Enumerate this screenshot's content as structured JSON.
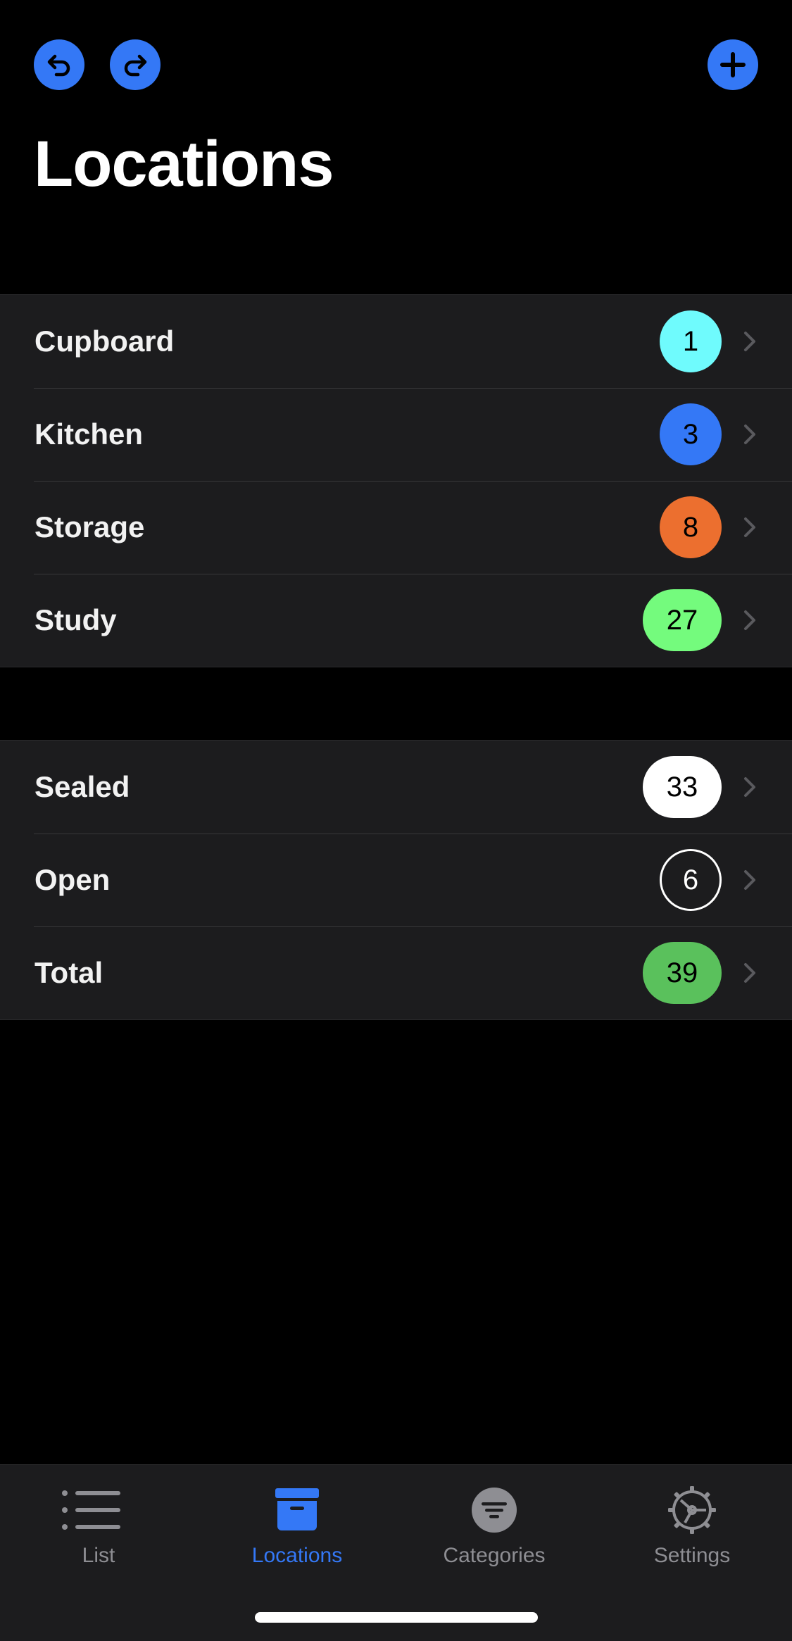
{
  "header": {
    "title": "Locations",
    "undo_icon": "undo-icon",
    "redo_icon": "redo-icon",
    "add_icon": "plus-icon",
    "accent_color": "#3478f6"
  },
  "locations": [
    {
      "label": "Cupboard",
      "count": "1",
      "color": "#6ffbfd"
    },
    {
      "label": "Kitchen",
      "count": "3",
      "color": "#3478f6"
    },
    {
      "label": "Storage",
      "count": "8",
      "color": "#ec6f2f"
    },
    {
      "label": "Study",
      "count": "27",
      "color": "#74fb7d"
    }
  ],
  "status": [
    {
      "label": "Sealed",
      "count": "33",
      "color": "#ffffff"
    },
    {
      "label": "Open",
      "count": "6",
      "color": "outline-white"
    },
    {
      "label": "Total",
      "count": "39",
      "color": "#5ac15c"
    }
  ],
  "tabbar": {
    "tabs": [
      {
        "label": "List",
        "icon": "list-icon",
        "active": false
      },
      {
        "label": "Locations",
        "icon": "archive-box-icon",
        "active": true
      },
      {
        "label": "Categories",
        "icon": "filter-circle-icon",
        "active": false
      },
      {
        "label": "Settings",
        "icon": "gear-icon",
        "active": false
      }
    ],
    "active_color": "#3478f6",
    "inactive_color": "#8e8e93"
  }
}
